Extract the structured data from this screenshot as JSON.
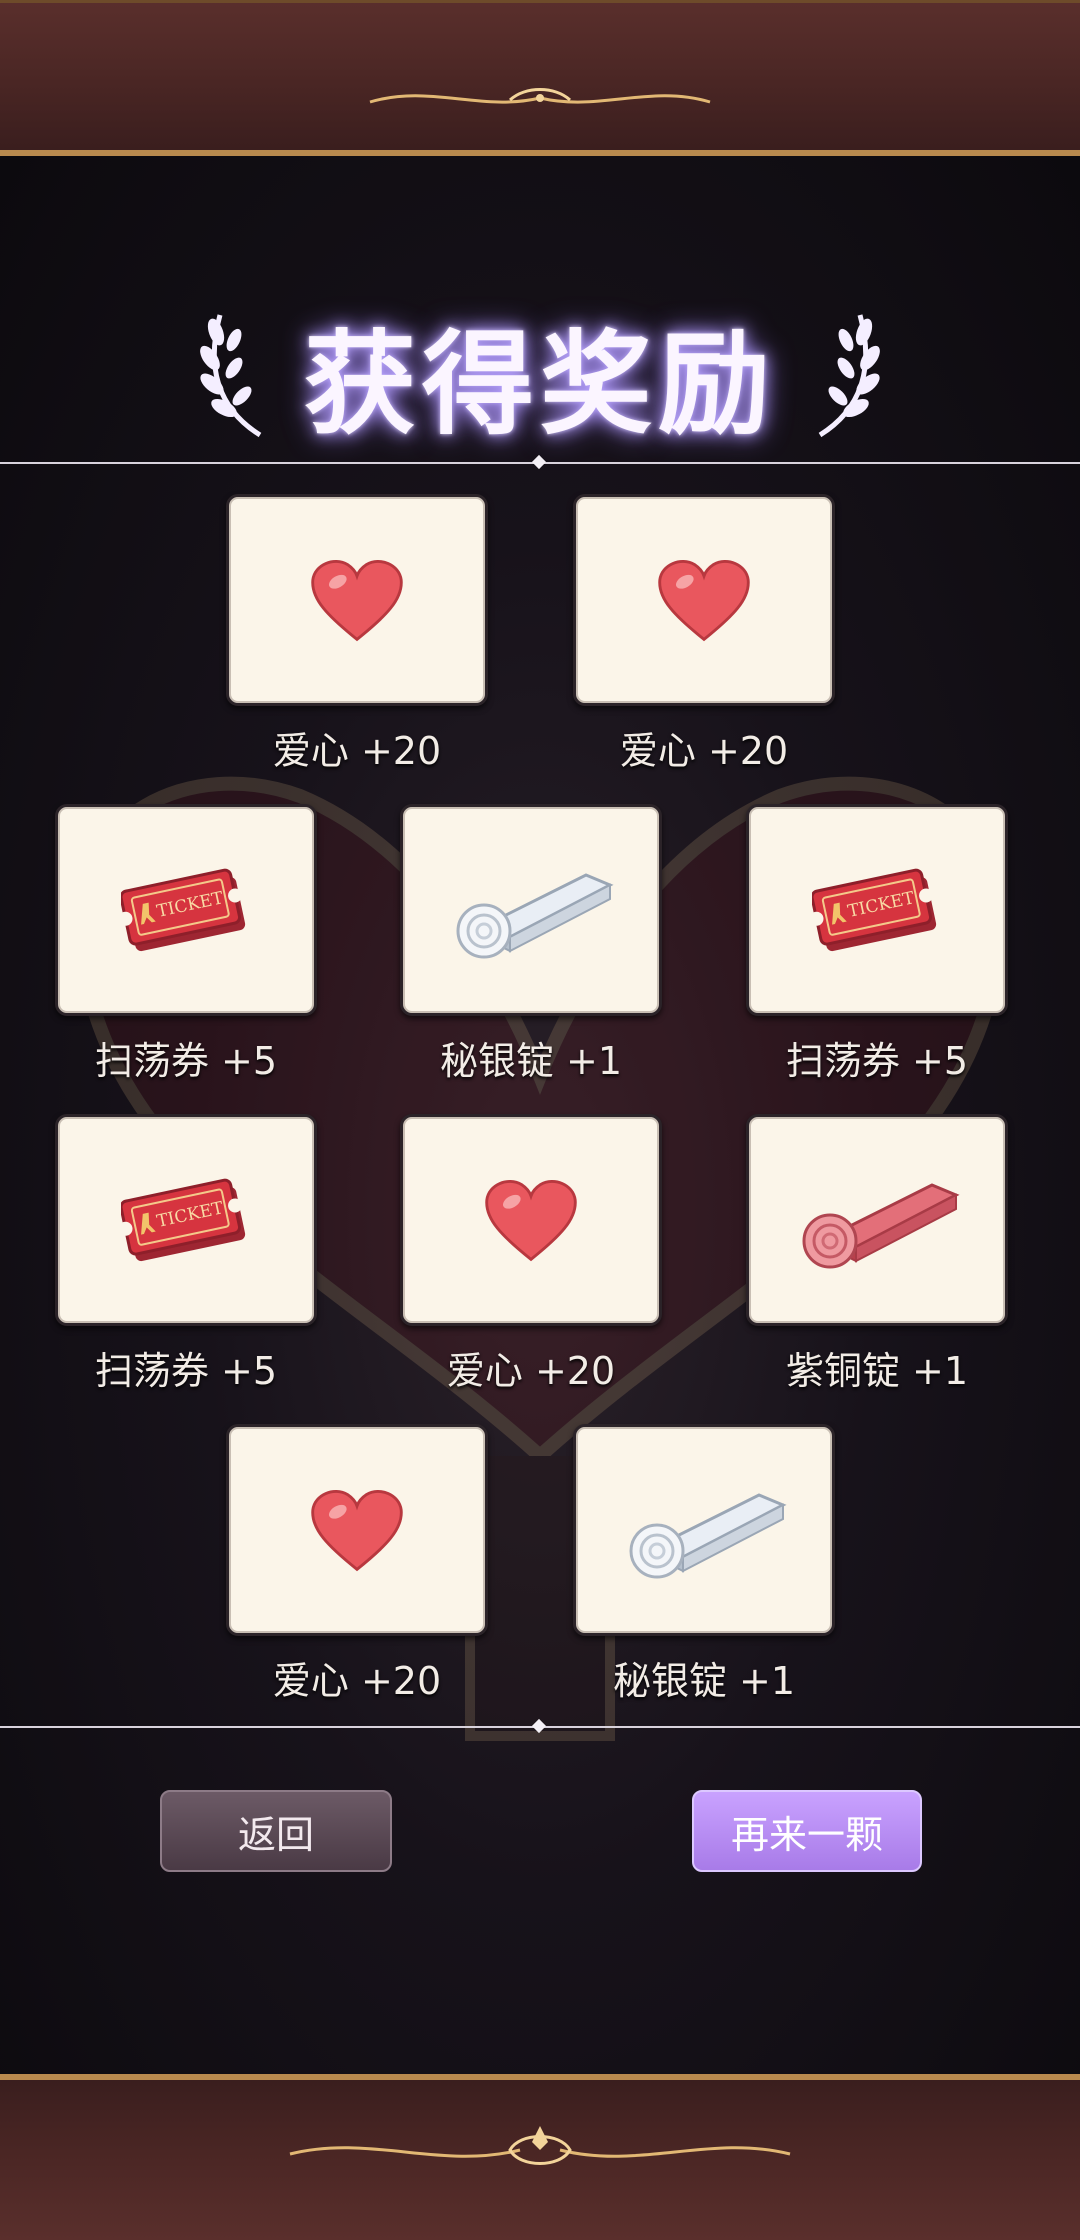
{
  "title": "获得奖励",
  "rewards": [
    {
      "label": "爱心 +20",
      "icon": "heart-icon"
    },
    {
      "label": "爱心 +20",
      "icon": "heart-icon"
    },
    {
      "label": "扫荡券 +5",
      "icon": "ticket-icon"
    },
    {
      "label": "秘银锭 +1",
      "icon": "silver-ingot-icon"
    },
    {
      "label": "扫荡券 +5",
      "icon": "ticket-icon"
    },
    {
      "label": "扫荡券 +5",
      "icon": "ticket-icon"
    },
    {
      "label": "爱心 +20",
      "icon": "heart-icon"
    },
    {
      "label": "紫铜锭 +1",
      "icon": "copper-ingot-icon"
    },
    {
      "label": "爱心 +20",
      "icon": "heart-icon"
    },
    {
      "label": "秘银锭 +1",
      "icon": "silver-ingot-icon"
    }
  ],
  "ticket_text": "TICKET",
  "buttons": {
    "back": "返回",
    "again": "再来一颗"
  },
  "colors": {
    "accent": "#b98a4e",
    "primary_button": "#b98cf2",
    "card_bg": "#fbf5e9"
  }
}
